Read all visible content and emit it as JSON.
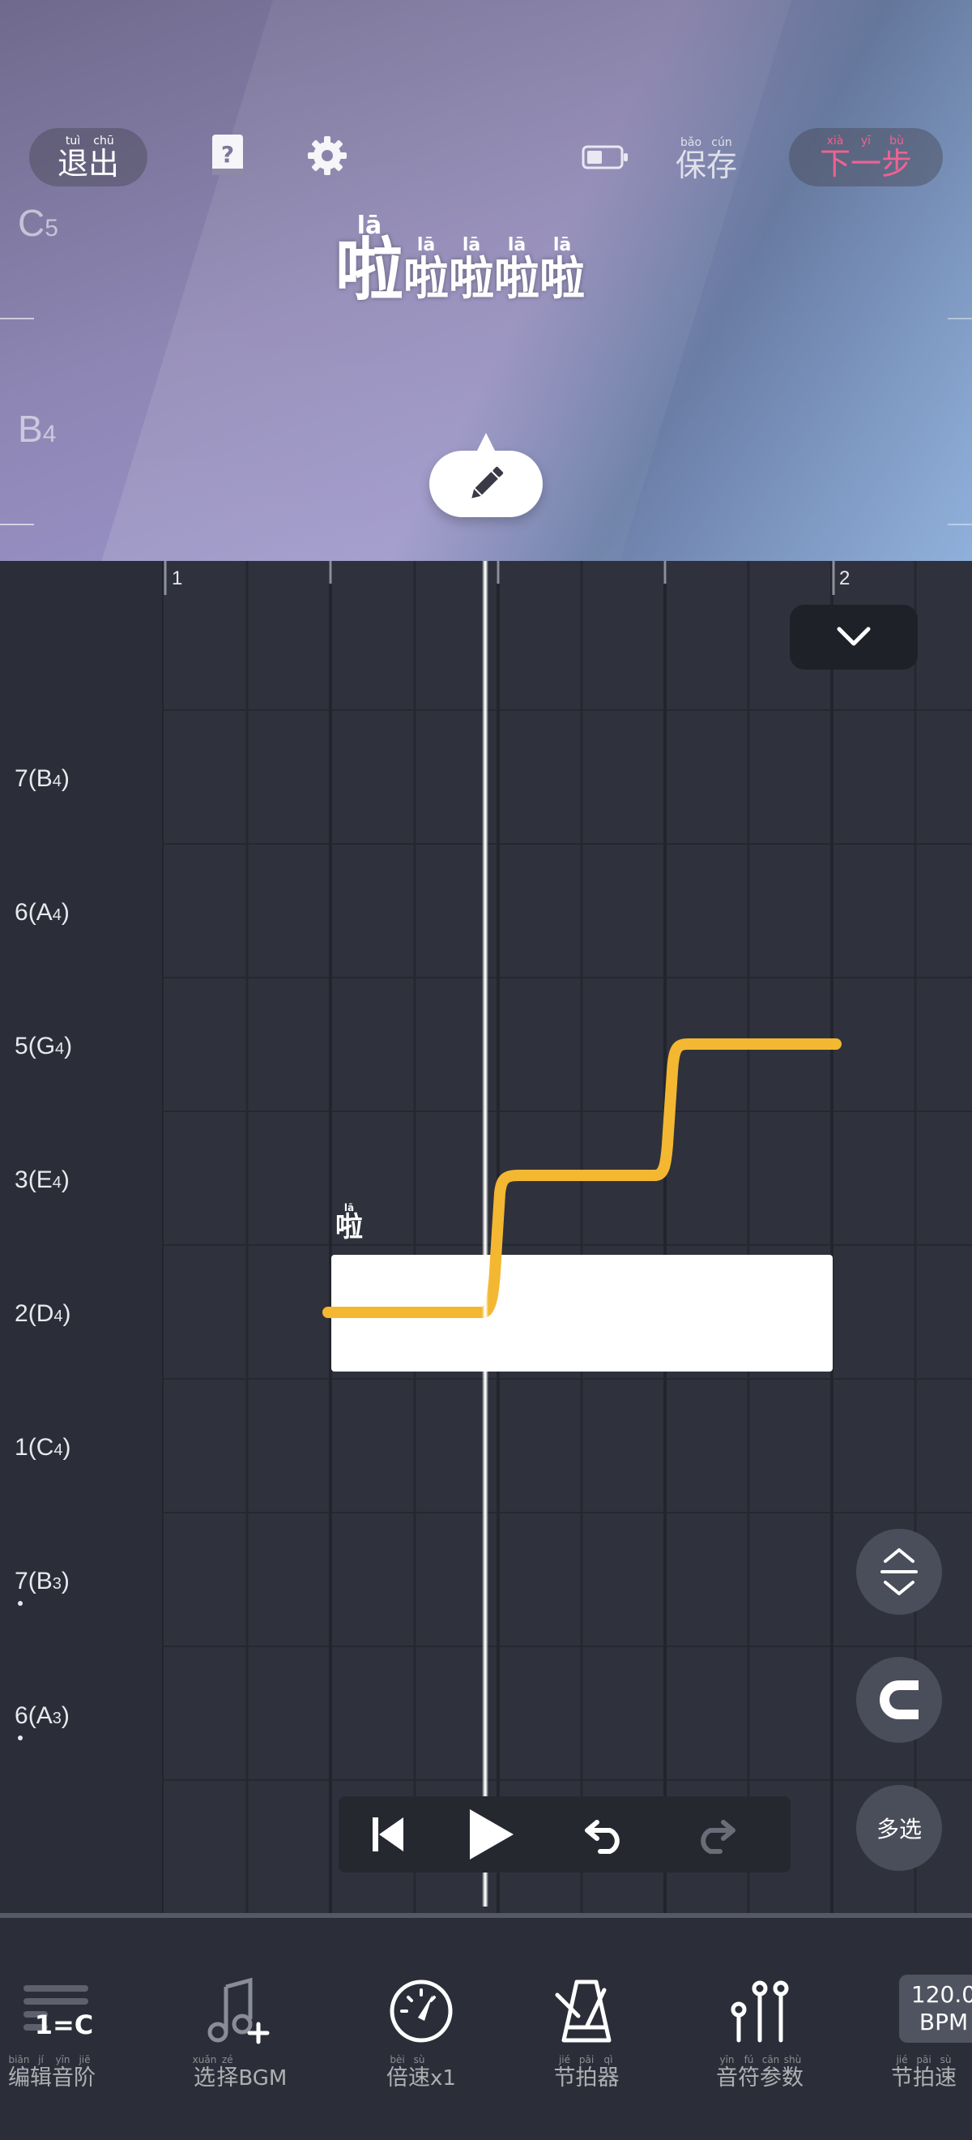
{
  "header": {
    "exit": [
      {
        "py": "tuì",
        "hz": "退"
      },
      {
        "py": "chū",
        "hz": "出"
      }
    ],
    "save": [
      {
        "py": "bǎo",
        "hz": "保"
      },
      {
        "py": "cún",
        "hz": "存"
      }
    ],
    "next": [
      {
        "py": "xià",
        "hz": "下"
      },
      {
        "py": "yī",
        "hz": "一"
      },
      {
        "py": "bù",
        "hz": "步"
      }
    ],
    "next_color": "#f06292",
    "help_icon": "question-book-icon",
    "settings_icon": "gear-icon",
    "battery_icon": "battery-icon"
  },
  "preview": {
    "note_c5": "C",
    "note_c5_oct": "5",
    "note_b4": "B",
    "note_b4_oct": "4",
    "lyrics": [
      {
        "py": "lā",
        "hz": "啦"
      },
      {
        "py": "lā",
        "hz": "啦"
      },
      {
        "py": "lā",
        "hz": "啦"
      },
      {
        "py": "lā",
        "hz": "啦"
      },
      {
        "py": "lā",
        "hz": "啦"
      }
    ],
    "edit_icon": "pencil-icon"
  },
  "roll": {
    "bar_1": "1",
    "bar_2": "2",
    "pitches": [
      {
        "deg": "7",
        "name": "B",
        "oct": "4"
      },
      {
        "deg": "6",
        "name": "A",
        "oct": "4"
      },
      {
        "deg": "5",
        "name": "G",
        "oct": "4"
      },
      {
        "deg": "3",
        "name": "E",
        "oct": "4"
      },
      {
        "deg": "2",
        "name": "D",
        "oct": "4"
      },
      {
        "deg": "1",
        "name": "C",
        "oct": "4"
      },
      {
        "deg": "7",
        "name": "B",
        "oct": "3"
      },
      {
        "deg": "6",
        "name": "A",
        "oct": "3"
      }
    ],
    "note_lyric": {
      "py": "lā",
      "hz": "啦"
    },
    "pitch_curve_color": "#f4b731",
    "multi_select": "多选"
  },
  "transport": {
    "skip_back_icon": "skip-back-icon",
    "play_icon": "play-icon",
    "undo_icon": "undo-icon",
    "redo_icon": "redo-icon"
  },
  "toolbar": {
    "scale_badge": "1=C",
    "scale_label": [
      {
        "py": "biān",
        "hz": "编"
      },
      {
        "py": "jí",
        "hz": "辑"
      },
      {
        "py": "yīn",
        "hz": "音"
      },
      {
        "py": "jiē",
        "hz": "阶"
      }
    ],
    "bgm_label_hz": [
      {
        "py": "xuǎn",
        "hz": "选"
      },
      {
        "py": "zé",
        "hz": "择"
      }
    ],
    "bgm_label_suffix": "BGM",
    "speed_label_hz": [
      {
        "py": "bèi",
        "hz": "倍"
      },
      {
        "py": "sù",
        "hz": "速"
      }
    ],
    "speed_label_suffix": "x1",
    "metronome_label": [
      {
        "py": "jié",
        "hz": "节"
      },
      {
        "py": "pāi",
        "hz": "拍"
      },
      {
        "py": "qì",
        "hz": "器"
      }
    ],
    "params_label": [
      {
        "py": "yīn",
        "hz": "音"
      },
      {
        "py": "fú",
        "hz": "符"
      },
      {
        "py": "cān",
        "hz": "参"
      },
      {
        "py": "shù",
        "hz": "数"
      }
    ],
    "bpm_value": "120.0",
    "bpm_unit": "BPM",
    "tempo_label": [
      {
        "py": "jié",
        "hz": "节"
      },
      {
        "py": "pāi",
        "hz": "拍"
      },
      {
        "py": "sù",
        "hz": "速"
      }
    ]
  }
}
